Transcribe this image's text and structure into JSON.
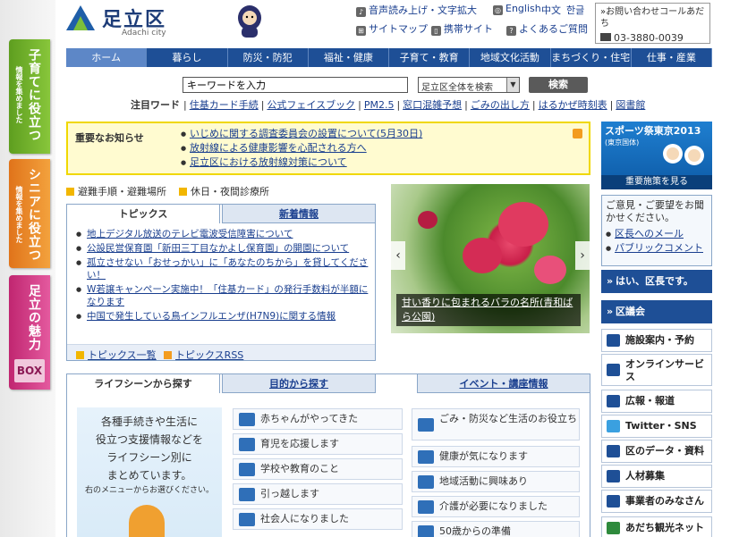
{
  "rail": {
    "tabs": [
      {
        "title": "子育てに役立つ",
        "sub": "情報を集めました"
      },
      {
        "title": "シニアに役立つ",
        "sub": "情報を集めました"
      },
      {
        "title": "足立の魅力",
        "sub": "BOX"
      }
    ]
  },
  "header": {
    "logo_text": "足立区",
    "logo_en": "Adachi city",
    "links": {
      "voice": "音声読み上げ・文字拡大",
      "english": "English",
      "chinese": "中文",
      "korean": "한글",
      "sitemap": "サイトマップ",
      "mobile": "携帯サイト",
      "faq": "よくあるご質問"
    },
    "callcenter": {
      "label": "»お問い合わせコールあだち",
      "tel": "03-3880-0039"
    }
  },
  "nav": {
    "items": [
      "ホーム",
      "暮らし",
      "防災・防犯",
      "福祉・健康",
      "子育て・教育",
      "地域文化活動",
      "まちづくり・住宅",
      "仕事・産業"
    ]
  },
  "search": {
    "placeholder": "キーワードを入力",
    "scope": "足立区全体を検索",
    "button": "検索"
  },
  "keywords": {
    "label": "注目ワード",
    "items": [
      "住基カード手続",
      "公式フェイスブック",
      "PM2.5",
      "窓口混雑予想",
      "ごみの出し方",
      "はるかぜ時刻表",
      "図書館"
    ]
  },
  "notice": {
    "label": "重要なお知らせ",
    "items": [
      "いじめに関する調査委員会の設置について(5月30日)",
      "放射線による健康影響を心配される方へ",
      "足立区における放射線対策について"
    ]
  },
  "quick": {
    "evac": "避難手順・避難場所",
    "night": "休日・夜間診療所"
  },
  "topics": {
    "tab_active": "トピックス",
    "tab_other": "新着情報",
    "items": [
      "地上デジタル放送のテレビ電波受信障害について",
      "公設民営保育園「新田三丁目なかよし保育園」の開園について",
      "孤立させない「おせっかい」に「あなたのちから」を貸してください！",
      "W若譲キャンペーン実施中！「住基カード」の発行手数料が半額になります",
      "中国で発生している鳥インフルエンザ(H7N9)に関する情報"
    ],
    "list_link": "トピックス一覧",
    "rss_link": "トピックスRSS"
  },
  "slide": {
    "caption": "甘い香りに包まれるバラの名所(青和ばら公園)"
  },
  "life": {
    "tabs": [
      "ライフシーンから探す",
      "目的から探す",
      "イベント・講座情報"
    ],
    "intro": [
      "各種手続きや生活に",
      "役立つ支援情報などを",
      "ライフシーン別に",
      "まとめています。"
    ],
    "intro_small": "右のメニューからお選びください。",
    "col1": [
      "赤ちゃんがやってきた",
      "育児を応援します",
      "学校や教育のこと",
      "引っ越します",
      "社会人になりました"
    ],
    "col2": [
      "ごみ・防災など生活のお役立ち",
      "健康が気になります",
      "地域活動に興味あり",
      "介護が必要になりました",
      "50歳からの準備"
    ]
  },
  "right": {
    "sports": {
      "title": "スポーツ祭東京2013",
      "sub": "(東京国体)",
      "button": "重要施策を見る"
    },
    "opinion": {
      "text": "ご意見・ご要望をお聞かせください。",
      "links": [
        "区長へのメール",
        "パブリックコメント"
      ]
    },
    "mayor": "はい、区長です。",
    "assembly": "区議会",
    "items": [
      "施設案内・予約",
      "オンラインサービス",
      "広報・報道",
      "Twitter・SNS",
      "区のデータ・資料",
      "人材募集",
      "事業者のみなさん",
      "あだち観光ネット"
    ]
  },
  "colors": {
    "nav": "#1e4f96",
    "notice_bg": "#fffbd0",
    "notice_border": "#f0d800",
    "link": "#1a3f8f"
  }
}
